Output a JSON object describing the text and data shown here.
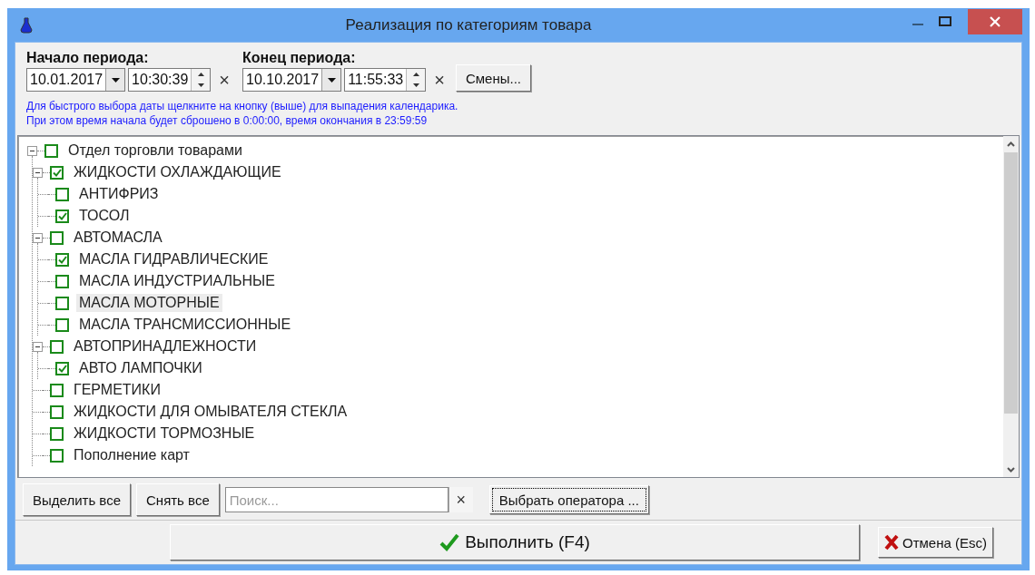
{
  "window": {
    "title": "Реализация по категориям товара"
  },
  "period_start": {
    "label": "Начало периода:",
    "date": "10.01.2017",
    "time": "10:30:39",
    "clear": "×"
  },
  "period_end": {
    "label": "Конец периода:",
    "date": "10.10.2017",
    "time": "11:55:33",
    "clear": "×"
  },
  "shifts_button": "Смены...",
  "hint": [
    "Для быстрого выбора даты щелкните на кнопку (выше) для выпадения календарика.",
    "При этом время начала будет сброшено в 0:00:00, время окончания в 23:59:59"
  ],
  "tree": [
    {
      "label": "Отдел торговли товарами",
      "checked": false,
      "selected": false,
      "expanded": true,
      "children": [
        {
          "label": "ЖИДКОСТИ ОХЛАЖДАЮЩИЕ",
          "checked": true,
          "selected": false,
          "expanded": true,
          "children": [
            {
              "label": "АНТИФРИЗ",
              "checked": false,
              "selected": false
            },
            {
              "label": "ТОСОЛ",
              "checked": true,
              "selected": false
            }
          ]
        },
        {
          "label": "АВТОМАСЛА",
          "checked": false,
          "selected": false,
          "expanded": true,
          "children": [
            {
              "label": "МАСЛА ГИДРАВЛИЧЕСКИЕ",
              "checked": true,
              "selected": false
            },
            {
              "label": "МАСЛА ИНДУСТРИАЛЬНЫЕ",
              "checked": false,
              "selected": false
            },
            {
              "label": "МАСЛА МОТОРНЫЕ",
              "checked": false,
              "selected": true
            },
            {
              "label": "МАСЛА ТРАНСМИССИОННЫЕ",
              "checked": false,
              "selected": false
            }
          ]
        },
        {
          "label": "АВТОПРИНАДЛЕЖНОСТИ",
          "checked": false,
          "selected": false,
          "expanded": true,
          "children": [
            {
              "label": "АВТО ЛАМПОЧКИ",
              "checked": true,
              "selected": false
            }
          ]
        },
        {
          "label": "ГЕРМЕТИКИ",
          "checked": false,
          "selected": false
        },
        {
          "label": "ЖИДКОСТИ ДЛЯ ОМЫВАТЕЛЯ СТЕКЛА",
          "checked": false,
          "selected": false
        },
        {
          "label": "ЖИДКОСТИ ТОРМОЗНЫЕ",
          "checked": false,
          "selected": false
        },
        {
          "label": "Пополнение карт",
          "checked": false,
          "selected": false
        }
      ]
    }
  ],
  "toolbar": {
    "select_all": "Выделить все",
    "clear_all": "Снять все",
    "search_placeholder": "Поиск...",
    "search_clear": "×",
    "operator_button": "Выбрать оператора ..."
  },
  "execute_button": "Выполнить (F4)",
  "cancel_button": "Отмена (Esc)"
}
